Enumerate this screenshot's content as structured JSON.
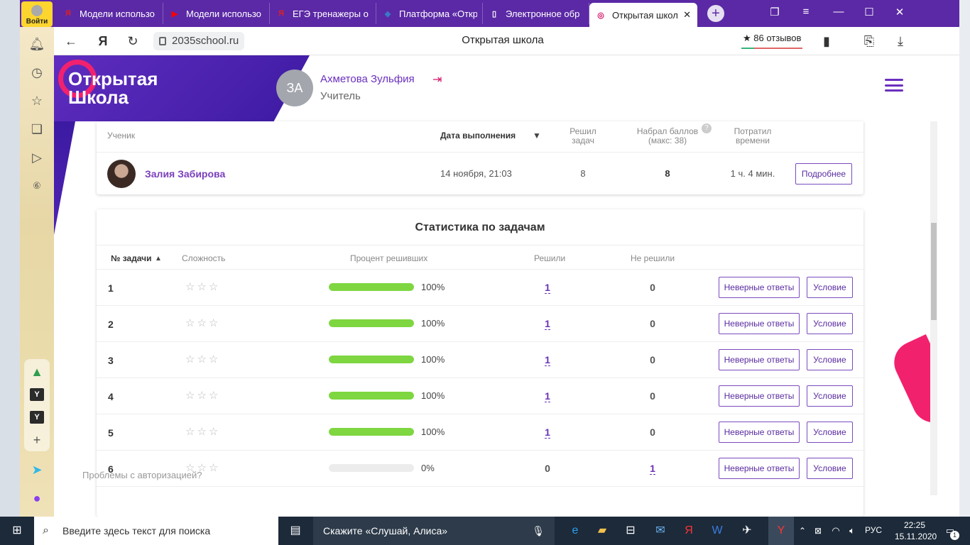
{
  "browser": {
    "login_label": "Войти",
    "tabs": [
      {
        "title": "Модели использо",
        "icon": "yandex-icon",
        "color": "#e02020"
      },
      {
        "title": "Модели использо",
        "icon": "youtube-icon",
        "color": "#ff0000"
      },
      {
        "title": "ЕГЭ тренажеры о",
        "icon": "yandex-icon",
        "color": "#e02020"
      },
      {
        "title": "Платформа «Откр",
        "icon": "platform-icon",
        "color": "#3a78c8"
      },
      {
        "title": "Электронное обр",
        "icon": "doc-icon",
        "color": "#ffffff"
      },
      {
        "title": "Открытая школ",
        "icon": "openschool-icon",
        "color": "#d4166a"
      }
    ],
    "url": "2035school.ru",
    "page_title": "Открытая школа",
    "reviews": "★ 86 отзывов"
  },
  "header": {
    "logo_line1": "Открытая",
    "logo_line2": "Школа",
    "user_initials": "ЗА",
    "user_name": "Ахметова Зульфия",
    "user_role": "Учитель"
  },
  "results": {
    "columns": {
      "student": "Ученик",
      "date": "Дата выполнения",
      "solved": "Решил задач",
      "score": "Набрал баллов (макс: 38)",
      "time": "Потратил времени"
    },
    "row": {
      "name": "Залия Забирова",
      "date": "14 ноября, 21:03",
      "solved": "8",
      "score": "8",
      "time": "1 ч. 4 мин.",
      "details_label": "Подробнее"
    }
  },
  "stats": {
    "title": "Статистика по задачам",
    "columns": {
      "num": "№ задачи",
      "difficulty": "Сложность",
      "percent": "Процент решивших",
      "solved": "Решили",
      "unsolved": "Не решили"
    },
    "wrong_label": "Неверные ответы",
    "cond_label": "Условие",
    "rows": [
      {
        "num": "1",
        "percent": "100%",
        "percent_value": 100,
        "solved": "1",
        "unsolved": "0"
      },
      {
        "num": "2",
        "percent": "100%",
        "percent_value": 100,
        "solved": "1",
        "unsolved": "0"
      },
      {
        "num": "3",
        "percent": "100%",
        "percent_value": 100,
        "solved": "1",
        "unsolved": "0"
      },
      {
        "num": "4",
        "percent": "100%",
        "percent_value": 100,
        "solved": "1",
        "unsolved": "0"
      },
      {
        "num": "5",
        "percent": "100%",
        "percent_value": 100,
        "solved": "1",
        "unsolved": "0"
      },
      {
        "num": "6",
        "percent": "0%",
        "percent_value": 0,
        "solved": "0",
        "unsolved": "1"
      }
    ]
  },
  "auth_link": "Проблемы с авторизацией?",
  "taskbar": {
    "search_placeholder": "Введите здесь текст для поиска",
    "alice": "Скажите «Слушай, Алиса»",
    "lang": "РУС",
    "time": "22:25",
    "date": "15.11.2020",
    "notifications": "1"
  },
  "colors": {
    "accent": "#6b2fbe",
    "brand_pink": "#f2216e",
    "progress_green": "#7ed640"
  }
}
